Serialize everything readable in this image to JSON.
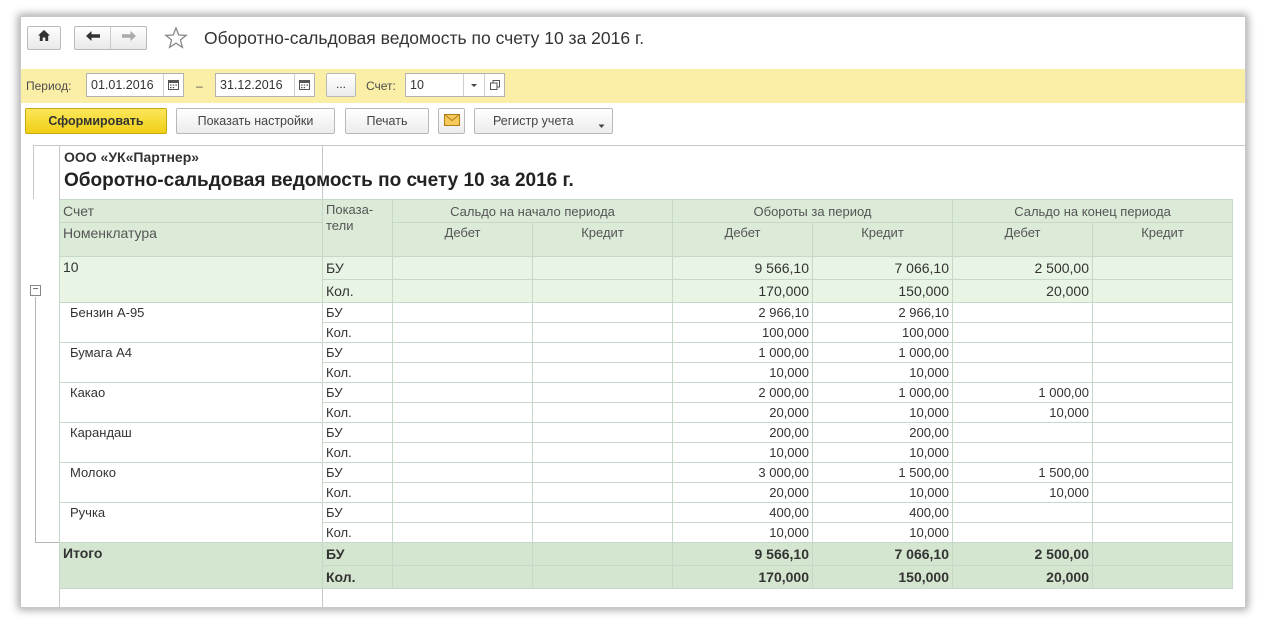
{
  "window_title": "Оборотно-сальдовая ведомость по счету 10 за 2016 г.",
  "icons": {
    "home": "home-icon",
    "back": "arrow-left-icon",
    "forward": "arrow-right-icon",
    "favorite": "star-icon",
    "calendar": "calendar-icon",
    "dropdown": "chevron-down-icon",
    "open": "open-form-icon",
    "email": "envelope-icon",
    "collapse": "minus-box-icon"
  },
  "period": {
    "label": "Период:",
    "from": "01.01.2016",
    "dash": "–",
    "to": "31.12.2016",
    "more": "...",
    "account_label": "Счет:",
    "account_value": "10"
  },
  "toolbar": {
    "generate": "Сформировать",
    "settings": "Показать настройки",
    "print": "Печать",
    "register": "Регистр учета"
  },
  "report": {
    "organization": "ООО «УК«Партнер»",
    "title": "Оборотно-сальдовая ведомость по счету 10 за 2016 г.",
    "headers": {
      "account": "Счет",
      "nomenclature": "Номенклатура",
      "indicators": "Показа-\nтели",
      "opening": "Сальдо на начало периода",
      "turnover": "Обороты за период",
      "closing": "Сальдо на конец периода",
      "debit": "Дебет",
      "credit": "Кредит"
    },
    "group": {
      "name": "10",
      "rows": [
        {
          "ind": "БУ",
          "vals": [
            "",
            "",
            "9 566,10",
            "7 066,10",
            "2 500,00",
            ""
          ]
        },
        {
          "ind": "Кол.",
          "vals": [
            "",
            "",
            "170,000",
            "150,000",
            "20,000",
            ""
          ]
        }
      ]
    },
    "items": [
      {
        "name": "Бензин А-95",
        "rows": [
          {
            "ind": "БУ",
            "vals": [
              "",
              "",
              "2 966,10",
              "2 966,10",
              "",
              ""
            ]
          },
          {
            "ind": "Кол.",
            "vals": [
              "",
              "",
              "100,000",
              "100,000",
              "",
              ""
            ]
          }
        ]
      },
      {
        "name": "Бумага А4",
        "rows": [
          {
            "ind": "БУ",
            "vals": [
              "",
              "",
              "1 000,00",
              "1 000,00",
              "",
              ""
            ]
          },
          {
            "ind": "Кол.",
            "vals": [
              "",
              "",
              "10,000",
              "10,000",
              "",
              ""
            ]
          }
        ]
      },
      {
        "name": "Какао",
        "rows": [
          {
            "ind": "БУ",
            "vals": [
              "",
              "",
              "2 000,00",
              "1 000,00",
              "1 000,00",
              ""
            ]
          },
          {
            "ind": "Кол.",
            "vals": [
              "",
              "",
              "20,000",
              "10,000",
              "10,000",
              ""
            ]
          }
        ]
      },
      {
        "name": "Карандаш",
        "rows": [
          {
            "ind": "БУ",
            "vals": [
              "",
              "",
              "200,00",
              "200,00",
              "",
              ""
            ]
          },
          {
            "ind": "Кол.",
            "vals": [
              "",
              "",
              "10,000",
              "10,000",
              "",
              ""
            ]
          }
        ]
      },
      {
        "name": "Молоко",
        "rows": [
          {
            "ind": "БУ",
            "vals": [
              "",
              "",
              "3 000,00",
              "1 500,00",
              "1 500,00",
              ""
            ]
          },
          {
            "ind": "Кол.",
            "vals": [
              "",
              "",
              "20,000",
              "10,000",
              "10,000",
              ""
            ]
          }
        ]
      },
      {
        "name": "Ручка",
        "rows": [
          {
            "ind": "БУ",
            "vals": [
              "",
              "",
              "400,00",
              "400,00",
              "",
              ""
            ]
          },
          {
            "ind": "Кол.",
            "vals": [
              "",
              "",
              "10,000",
              "10,000",
              "",
              ""
            ]
          }
        ]
      }
    ],
    "total": {
      "name": "Итого",
      "rows": [
        {
          "ind": "БУ",
          "vals": [
            "",
            "",
            "9 566,10",
            "7 066,10",
            "2 500,00",
            ""
          ]
        },
        {
          "ind": "Кол.",
          "vals": [
            "",
            "",
            "170,000",
            "150,000",
            "20,000",
            ""
          ]
        }
      ]
    }
  }
}
